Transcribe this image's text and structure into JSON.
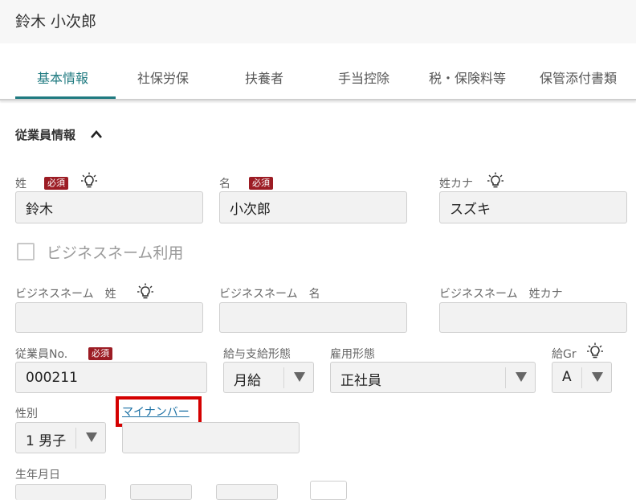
{
  "header": {
    "title": "鈴木 小次郎"
  },
  "tabs": [
    {
      "label": "基本情報",
      "active": true
    },
    {
      "label": "社保労保"
    },
    {
      "label": "扶養者"
    },
    {
      "label": "手当控除"
    },
    {
      "label": "税・保険料等"
    },
    {
      "label": "保管添付書類"
    }
  ],
  "section": {
    "title": "従業員情報"
  },
  "required_label": "必須",
  "fields": {
    "last_name": {
      "label": "姓",
      "value": "鈴木"
    },
    "first_name": {
      "label": "名",
      "value": "小次郎"
    },
    "last_name_kana": {
      "label": "姓カナ",
      "value": "スズキ"
    },
    "business_name_use": {
      "label": "ビジネスネーム利用",
      "checked": false
    },
    "bn_last": {
      "label": "ビジネスネーム　姓",
      "value": ""
    },
    "bn_first": {
      "label": "ビジネスネーム　名",
      "value": ""
    },
    "bn_kana": {
      "label": "ビジネスネーム　姓カナ",
      "value": ""
    },
    "employee_no": {
      "label": "従業員No.",
      "value": "000211"
    },
    "pay_type": {
      "label": "給与支給形態",
      "value": "月給"
    },
    "employment_type": {
      "label": "雇用形態",
      "value": "正社員"
    },
    "pay_grade": {
      "label": "給Gr",
      "value": "A"
    },
    "gender": {
      "label": "性別",
      "value": "1 男子"
    },
    "my_number": {
      "label": "マイナンバー",
      "value": ""
    },
    "birth_date": {
      "label": "生年月日"
    }
  },
  "colors": {
    "accent": "#1f7a80",
    "required": "#9c1c24",
    "highlight": "#d40000",
    "link": "#1a6fa3"
  }
}
